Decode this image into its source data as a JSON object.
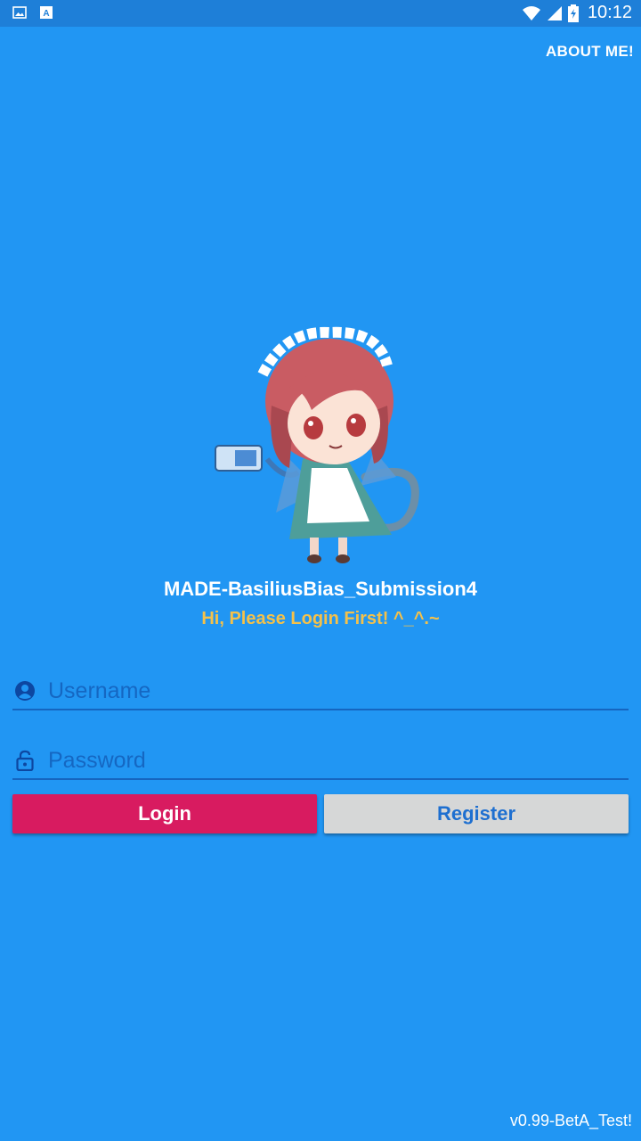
{
  "status_bar": {
    "time": "10:12",
    "left_icons": [
      "image-icon",
      "text-a-icon"
    ],
    "right_icons": [
      "wifi-icon",
      "signal-icon",
      "battery-icon"
    ]
  },
  "header": {
    "about_label": "ABOUT ME!"
  },
  "main": {
    "title": "MADE-BasiliusBias_Submission4",
    "subtitle": "Hi, Please Login First! ^_^.~",
    "username_placeholder": "Username",
    "password_placeholder": "Password",
    "login_label": "Login",
    "register_label": "Register"
  },
  "footer": {
    "version": "v0.99-BetA_Test!"
  },
  "colors": {
    "background": "#2196F3",
    "status_bar": "#1E7FD8",
    "login_button": "#D81B60",
    "register_button": "#D6D7D7",
    "subtitle": "#F4C14A"
  }
}
